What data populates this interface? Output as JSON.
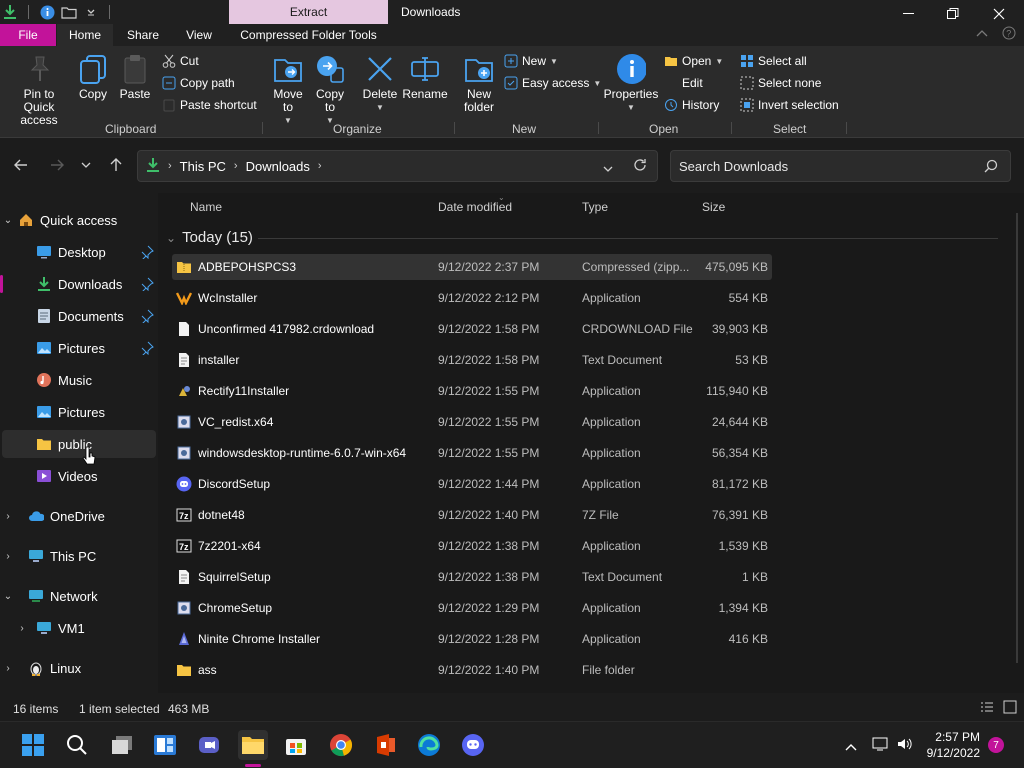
{
  "titlebar": {
    "context_tab": "Extract",
    "title": "Downloads"
  },
  "ribbon_tabs": {
    "file": "File",
    "home": "Home",
    "share": "Share",
    "view": "View",
    "compressed": "Compressed Folder Tools"
  },
  "ribbon": {
    "pin_label": "Pin to Quick access",
    "copy": "Copy",
    "paste": "Paste",
    "cut": "Cut",
    "copy_path": "Copy path",
    "paste_shortcut": "Paste shortcut",
    "move_to": "Move to",
    "copy_to": "Copy to",
    "delete": "Delete",
    "rename": "Rename",
    "new_folder": "New folder",
    "new_item": "New",
    "easy_access": "Easy access",
    "properties": "Properties",
    "open": "Open",
    "edit": "Edit",
    "history": "History",
    "select_all": "Select all",
    "select_none": "Select none",
    "invert_selection": "Invert selection",
    "groups": {
      "clipboard": "Clipboard",
      "organize": "Organize",
      "new": "New",
      "open": "Open",
      "select": "Select"
    }
  },
  "address": {
    "crumbs": [
      "This PC",
      "Downloads"
    ],
    "search_placeholder": "Search Downloads"
  },
  "sidebar": {
    "quick_access": "Quick access",
    "items": [
      {
        "label": "Desktop"
      },
      {
        "label": "Downloads"
      },
      {
        "label": "Documents"
      },
      {
        "label": "Pictures"
      },
      {
        "label": "Music"
      },
      {
        "label": "Pictures"
      },
      {
        "label": "public"
      },
      {
        "label": "Videos"
      }
    ],
    "onedrive": "OneDrive",
    "this_pc": "This PC",
    "network": "Network",
    "vm1": "VM1",
    "linux": "Linux"
  },
  "columns": {
    "name": "Name",
    "date": "Date modified",
    "type": "Type",
    "size": "Size"
  },
  "group_header": "Today (15)",
  "files": [
    {
      "name": "ADBEPOHSPCS3",
      "date": "9/12/2022 2:37 PM",
      "type": "Compressed (zipp...",
      "size": "475,095 KB"
    },
    {
      "name": "WcInstaller",
      "date": "9/12/2022 2:12 PM",
      "type": "Application",
      "size": "554 KB"
    },
    {
      "name": "Unconfirmed 417982.crdownload",
      "date": "9/12/2022 1:58 PM",
      "type": "CRDOWNLOAD File",
      "size": "39,903 KB"
    },
    {
      "name": "installer",
      "date": "9/12/2022 1:58 PM",
      "type": "Text Document",
      "size": "53 KB"
    },
    {
      "name": "Rectify11Installer",
      "date": "9/12/2022 1:55 PM",
      "type": "Application",
      "size": "115,940 KB"
    },
    {
      "name": "VC_redist.x64",
      "date": "9/12/2022 1:55 PM",
      "type": "Application",
      "size": "24,644 KB"
    },
    {
      "name": "windowsdesktop-runtime-6.0.7-win-x64",
      "date": "9/12/2022 1:55 PM",
      "type": "Application",
      "size": "56,354 KB"
    },
    {
      "name": "DiscordSetup",
      "date": "9/12/2022 1:44 PM",
      "type": "Application",
      "size": "81,172 KB"
    },
    {
      "name": "dotnet48",
      "date": "9/12/2022 1:40 PM",
      "type": "7Z File",
      "size": "76,391 KB"
    },
    {
      "name": "7z2201-x64",
      "date": "9/12/2022 1:38 PM",
      "type": "Application",
      "size": "1,539 KB"
    },
    {
      "name": "SquirrelSetup",
      "date": "9/12/2022 1:38 PM",
      "type": "Text Document",
      "size": "1 KB"
    },
    {
      "name": "ChromeSetup",
      "date": "9/12/2022 1:29 PM",
      "type": "Application",
      "size": "1,394 KB"
    },
    {
      "name": "Ninite Chrome Installer",
      "date": "9/12/2022 1:28 PM",
      "type": "Application",
      "size": "416 KB"
    },
    {
      "name": "ass",
      "date": "9/12/2022 1:40 PM",
      "type": "File folder",
      "size": ""
    }
  ],
  "status": {
    "items": "16 items",
    "selected": "1 item selected",
    "size": "463 MB"
  },
  "taskbar": {
    "time": "2:57 PM",
    "date": "9/12/2022",
    "notifications": "7"
  },
  "colors": {
    "accent": "#c2139a",
    "context_tab": "#e5c7e0",
    "blue_icon": "#4aa3f0",
    "folder": "#f6c443"
  }
}
